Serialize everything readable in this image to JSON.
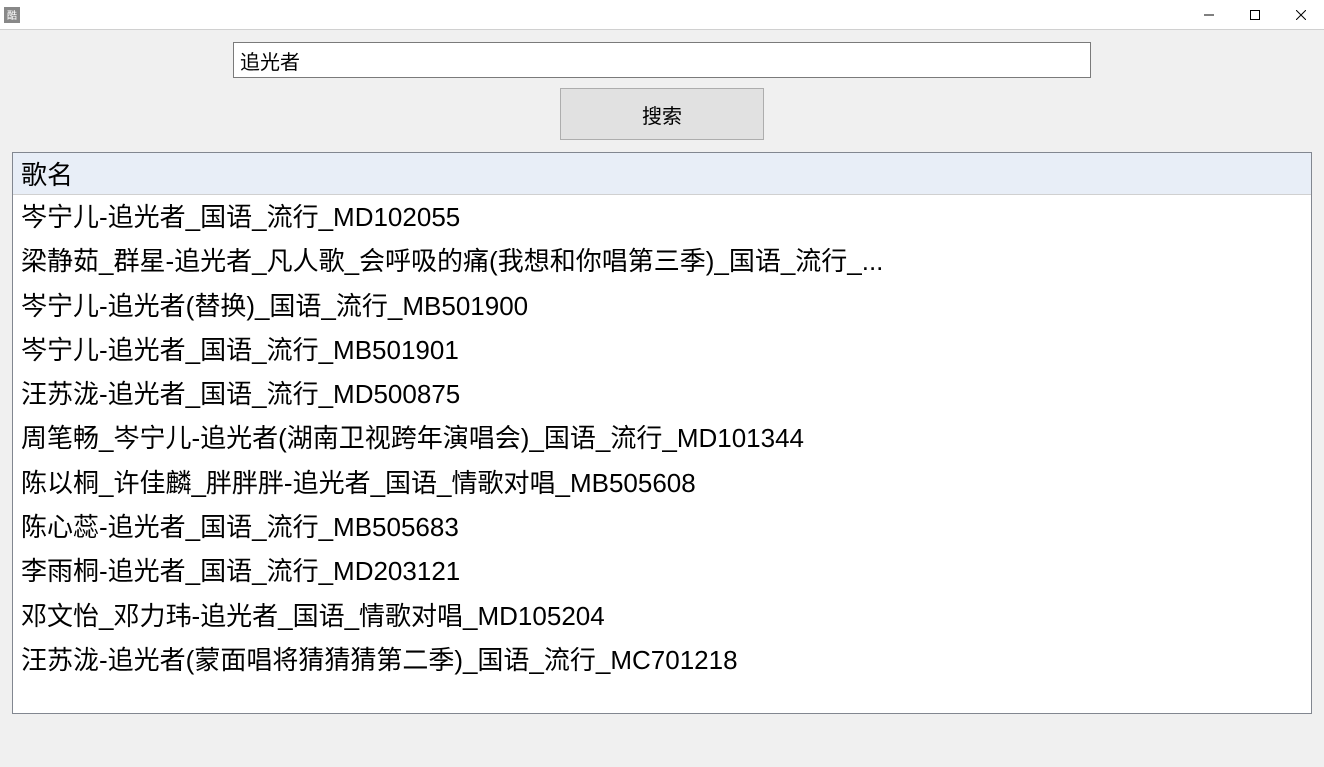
{
  "titlebar": {
    "title": ""
  },
  "search": {
    "input_value": "追光者",
    "button_label": "搜索"
  },
  "list": {
    "header": "歌名",
    "items": [
      "岑宁儿-追光者_国语_流行_MD102055",
      "梁静茹_群星-追光者_凡人歌_会呼吸的痛(我想和你唱第三季)_国语_流行_...",
      "岑宁儿-追光者(替换)_国语_流行_MB501900",
      "岑宁儿-追光者_国语_流行_MB501901",
      "汪苏泷-追光者_国语_流行_MD500875",
      "周笔畅_岑宁儿-追光者(湖南卫视跨年演唱会)_国语_流行_MD101344",
      "陈以桐_许佳麟_胖胖胖-追光者_国语_情歌对唱_MB505608",
      "陈心蕊-追光者_国语_流行_MB505683",
      "李雨桐-追光者_国语_流行_MD203121",
      "邓文怡_邓力玮-追光者_国语_情歌对唱_MD105204",
      "汪苏泷-追光者(蒙面唱将猜猜猜第二季)_国语_流行_MC701218"
    ]
  }
}
